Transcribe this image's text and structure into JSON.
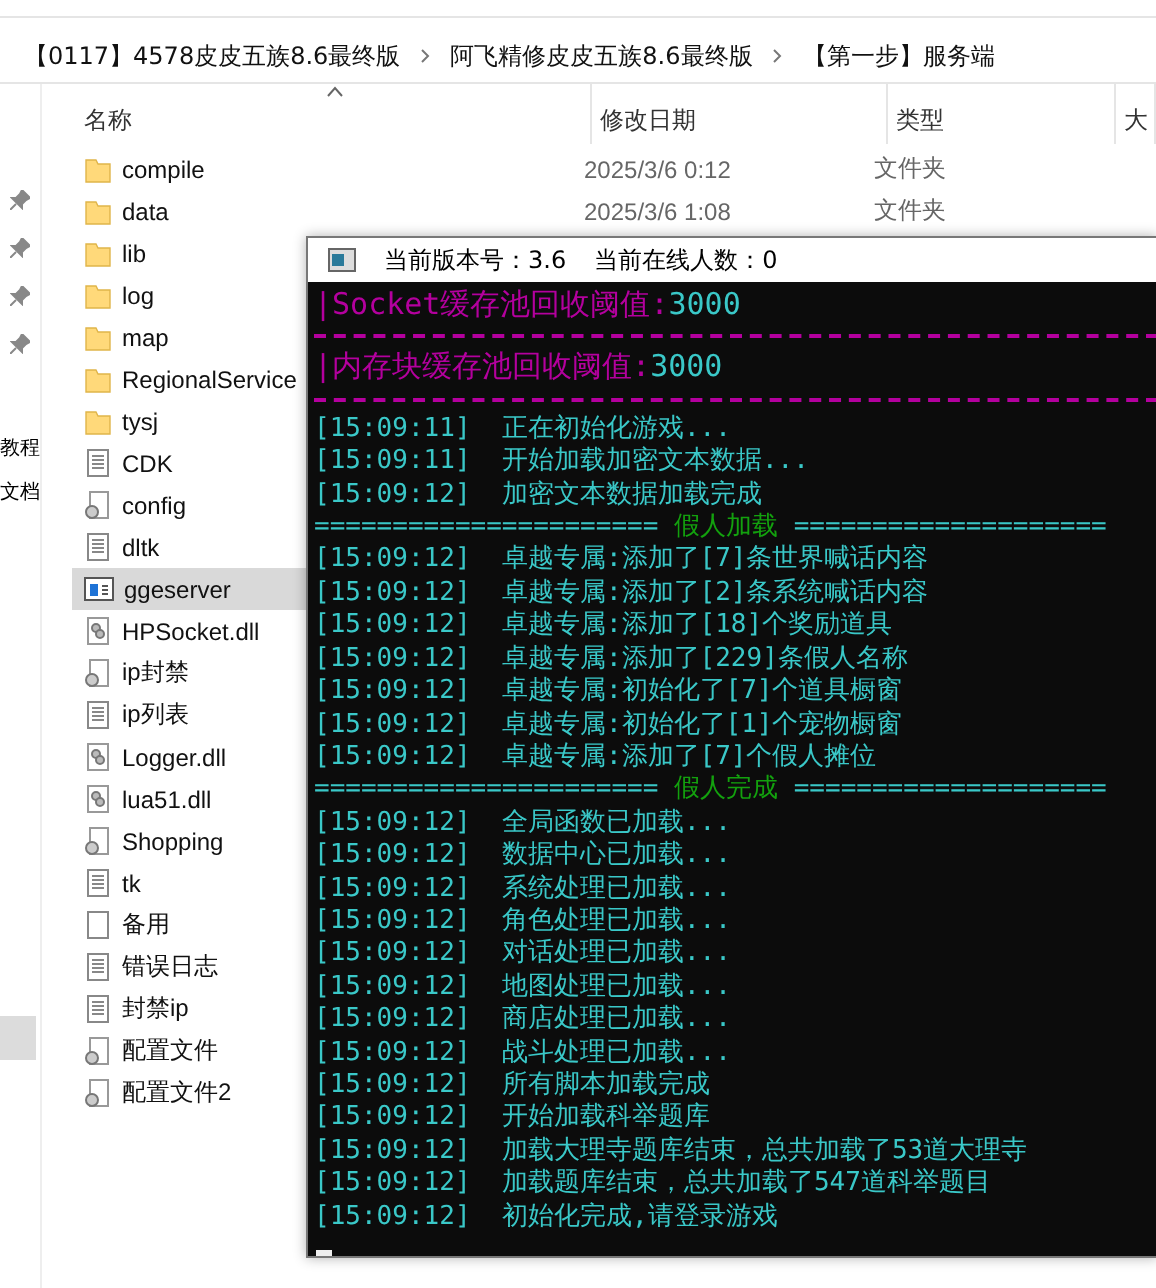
{
  "breadcrumb": [
    "【0117】4578皮皮五族8.6最终版",
    "阿飞精修皮皮五族8.6最终版",
    "【第一步】服务端"
  ],
  "nav": {
    "items": [
      {
        "label": "教程"
      },
      {
        "label": "文档"
      }
    ]
  },
  "columns": [
    {
      "label": "名称",
      "sorted": true
    },
    {
      "label": "修改日期",
      "sorted": false
    },
    {
      "label": "类型",
      "sorted": false
    },
    {
      "label": "大",
      "sorted": false
    }
  ],
  "files": [
    {
      "name": "compile",
      "kind": "folder",
      "date": "2025/3/6 0:12",
      "type": "文件夹",
      "selected": false
    },
    {
      "name": "data",
      "kind": "folder",
      "date": "2025/3/6 1:08",
      "type": "文件夹",
      "selected": false
    },
    {
      "name": "lib",
      "kind": "folder",
      "selected": false
    },
    {
      "name": "log",
      "kind": "folder",
      "selected": false
    },
    {
      "name": "map",
      "kind": "folder",
      "selected": false
    },
    {
      "name": "RegionalService",
      "kind": "folder",
      "selected": false
    },
    {
      "name": "tysj",
      "kind": "folder",
      "selected": false
    },
    {
      "name": "CDK",
      "kind": "text",
      "selected": false
    },
    {
      "name": "config",
      "kind": "config",
      "selected": false
    },
    {
      "name": "dltk",
      "kind": "text",
      "selected": false
    },
    {
      "name": "ggeserver",
      "kind": "app",
      "selected": true
    },
    {
      "name": "HPSocket.dll",
      "kind": "dll",
      "selected": false
    },
    {
      "name": "ip封禁",
      "kind": "config",
      "selected": false
    },
    {
      "name": "ip列表",
      "kind": "text",
      "selected": false
    },
    {
      "name": "Logger.dll",
      "kind": "dll",
      "selected": false
    },
    {
      "name": "lua51.dll",
      "kind": "dll",
      "selected": false
    },
    {
      "name": "Shopping",
      "kind": "config",
      "selected": false
    },
    {
      "name": "tk",
      "kind": "text",
      "selected": false
    },
    {
      "name": "备用",
      "kind": "blank",
      "selected": false
    },
    {
      "name": "错误日志",
      "kind": "text",
      "selected": false
    },
    {
      "name": "封禁ip",
      "kind": "text",
      "selected": false
    },
    {
      "name": "配置文件",
      "kind": "config",
      "selected": false
    },
    {
      "name": "配置文件2",
      "kind": "config",
      "selected": false
    }
  ],
  "console": {
    "title_parts": [
      "当前版本号：3.6",
      "当前在线人数：0"
    ],
    "lines": [
      {
        "kind": "setting",
        "label": "|Socket缓存池回收阈值:",
        "value": "3000"
      },
      {
        "kind": "divider"
      },
      {
        "kind": "setting",
        "label": "|内存块缓存池回收阈值:",
        "value": "3000"
      },
      {
        "kind": "divider"
      },
      {
        "kind": "log",
        "time": "[15:09:11]",
        "text": "正在初始化游戏..."
      },
      {
        "kind": "log",
        "time": "[15:09:11]",
        "text": "开始加载加密文本数据..."
      },
      {
        "kind": "log",
        "time": "[15:09:12]",
        "text": "加密文本数据加载完成"
      },
      {
        "kind": "section",
        "left": "======================",
        "title": "假人加载",
        "right": "===================="
      },
      {
        "kind": "log",
        "time": "[15:09:12]",
        "text": "卓越专属:添加了[7]条世界喊话内容"
      },
      {
        "kind": "log",
        "time": "[15:09:12]",
        "text": "卓越专属:添加了[2]条系统喊话内容"
      },
      {
        "kind": "log",
        "time": "[15:09:12]",
        "text": "卓越专属:添加了[18]个奖励道具"
      },
      {
        "kind": "log",
        "time": "[15:09:12]",
        "text": "卓越专属:添加了[229]条假人名称"
      },
      {
        "kind": "log",
        "time": "[15:09:12]",
        "text": "卓越专属:初始化了[7]个道具橱窗"
      },
      {
        "kind": "log",
        "time": "[15:09:12]",
        "text": "卓越专属:初始化了[1]个宠物橱窗"
      },
      {
        "kind": "log",
        "time": "[15:09:12]",
        "text": "卓越专属:添加了[7]个假人摊位"
      },
      {
        "kind": "section",
        "left": "======================",
        "title": "假人完成",
        "right": "===================="
      },
      {
        "kind": "log",
        "time": "[15:09:12]",
        "text": "全局函数已加载..."
      },
      {
        "kind": "log",
        "time": "[15:09:12]",
        "text": "数据中心已加载..."
      },
      {
        "kind": "log",
        "time": "[15:09:12]",
        "text": "系统处理已加载..."
      },
      {
        "kind": "log",
        "time": "[15:09:12]",
        "text": "角色处理已加载..."
      },
      {
        "kind": "log",
        "time": "[15:09:12]",
        "text": "对话处理已加载..."
      },
      {
        "kind": "log",
        "time": "[15:09:12]",
        "text": "地图处理已加载..."
      },
      {
        "kind": "log",
        "time": "[15:09:12]",
        "text": "商店处理已加载..."
      },
      {
        "kind": "log",
        "time": "[15:09:12]",
        "text": "战斗处理已加载..."
      },
      {
        "kind": "log",
        "time": "[15:09:12]",
        "text": "所有脚本加载完成"
      },
      {
        "kind": "log",
        "time": "[15:09:12]",
        "text": "开始加载科举题库"
      },
      {
        "kind": "log",
        "time": "[15:09:12]",
        "text": "加载大理寺题库结束，总共加载了53道大理寺"
      },
      {
        "kind": "log",
        "time": "[15:09:12]",
        "text": "加载题库结束，总共加载了547道科举题目"
      },
      {
        "kind": "log",
        "time": "[15:09:12]",
        "text": "初始化完成,请登录游戏"
      }
    ]
  }
}
